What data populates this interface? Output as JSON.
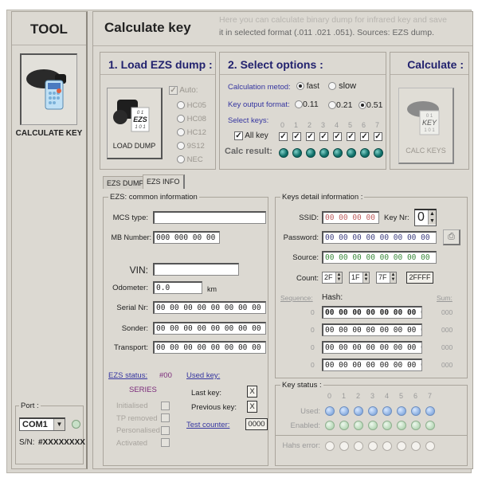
{
  "sidebar": {
    "title": "TOOL",
    "tool_label": "CALCULATE KEY",
    "port": {
      "legend": "Port :",
      "value": "COM1",
      "sn_label": "S/N:",
      "sn_value": "#XXXXXXXX"
    }
  },
  "header": {
    "title": "Calculate key",
    "desc_line1": "Here you can calculate binary dump for infrared key and save",
    "desc_line2": "it in selected format (.011 .021 .051). Sources:  EZS dump."
  },
  "load": {
    "title": "1. Load EZS dump :",
    "button_label": "LOAD DUMP",
    "auto_label": "Auto:",
    "auto_checked": true,
    "chips": [
      "HC05",
      "HC08",
      "HC12",
      "9S12",
      "NEC"
    ],
    "icon_text": [
      "0 1",
      "EZS",
      "1 0 1"
    ]
  },
  "options": {
    "title": "2. Select options :",
    "method_label": "Calculation metod:",
    "method_options": [
      "fast",
      "slow"
    ],
    "method_selected": "fast",
    "format_label": "Key output format:",
    "format_options": [
      "0.11",
      "0.21",
      "0.51"
    ],
    "format_selected": "0.51",
    "select_keys_label": "Select keys:",
    "all_key_label": "All key",
    "key_numbers": [
      "0",
      "1",
      "2",
      "3",
      "4",
      "5",
      "6",
      "7"
    ],
    "calc_result_label": "Calc result:"
  },
  "calculate": {
    "title": "Calculate :",
    "button_label": "CALC KEYS",
    "icon_text": [
      "0 1",
      "KEY",
      "1 0 1"
    ]
  },
  "tabs": [
    {
      "label": "EZS DUMP",
      "active": false
    },
    {
      "label": "EZS INFO",
      "active": true
    }
  ],
  "ezs_info": {
    "legend": "EZS: common information",
    "mcs_type_label": "MCS type:",
    "mcs_type_value": "",
    "mb_number_label": "MB Number:",
    "mb_number_value": "000 000 00 00",
    "vin_label": "VIN:",
    "vin_value": "",
    "odometer_label": "Odometer:",
    "odometer_value": "0.0",
    "odometer_unit": "km",
    "serial_label": "Serial Nr:",
    "serial_value": "00 00 00 00 00 00 00 00",
    "sonder_label": "Sonder:",
    "sonder_value": "00 00 00 00 00 00 00 00",
    "transport_label": "Transport:",
    "transport_value": "00 00 00 00 00 00 00 00",
    "ezs_status_label": "EZS status:",
    "ezs_status_value": "#00",
    "series_label": "SERIES",
    "status_flags": [
      "Initialised",
      "TP removed",
      "Personalised",
      "Activated"
    ],
    "used_key_label": "Used key:",
    "last_key_label": "Last key:",
    "last_key_value": "X",
    "prev_key_label": "Previous key:",
    "prev_key_value": "X",
    "test_counter_label": "Test counter:",
    "test_counter_value": "0000"
  },
  "keys_detail": {
    "legend": "Keys detail information :",
    "ssid_label": "SSID:",
    "ssid_value": "00 00 00 00",
    "key_nr_label": "Key Nr:",
    "key_nr_value": "0",
    "password_label": "Password:",
    "password_value": "00 00 00 00 00 00 00 00",
    "source_label": "Source:",
    "source_value": "00 00 00 00 00 00 00 00",
    "count_label": "Count:",
    "count_values": [
      "2F",
      "1F",
      "7F"
    ],
    "count_total": "2FFFF",
    "sequence_label": "Sequence:",
    "hash_label": "Hash:",
    "sum_label": "Sum:",
    "hash_rows": [
      {
        "seq": "0",
        "hash": "00 00 00 00 00 00 00 00",
        "sum": "000"
      },
      {
        "seq": "0",
        "hash": "00 00 00 00 00 00 00 00",
        "sum": "000"
      },
      {
        "seq": "0",
        "hash": "00 00 00 00 00 00 00 00",
        "sum": "000"
      },
      {
        "seq": "0",
        "hash": "00 00 00 00 00 00 00 00",
        "sum": "000"
      }
    ]
  },
  "key_status": {
    "legend": "Key status :",
    "numbers": [
      "0",
      "1",
      "2",
      "3",
      "4",
      "5",
      "6",
      "7"
    ],
    "used_label": "Used:",
    "enabled_label": "Enabled:",
    "hash_error_label": "Hahs error:"
  },
  "colors": {
    "accent_title": "#22226e",
    "option_label": "#3535a0",
    "calc_led": "#0f6f68",
    "used_led": "#8aaee0",
    "enabled_led": "#b8d8b8",
    "ssid_text": "#c06060",
    "password_text": "#404080",
    "source_text": "#3a8a3a"
  }
}
